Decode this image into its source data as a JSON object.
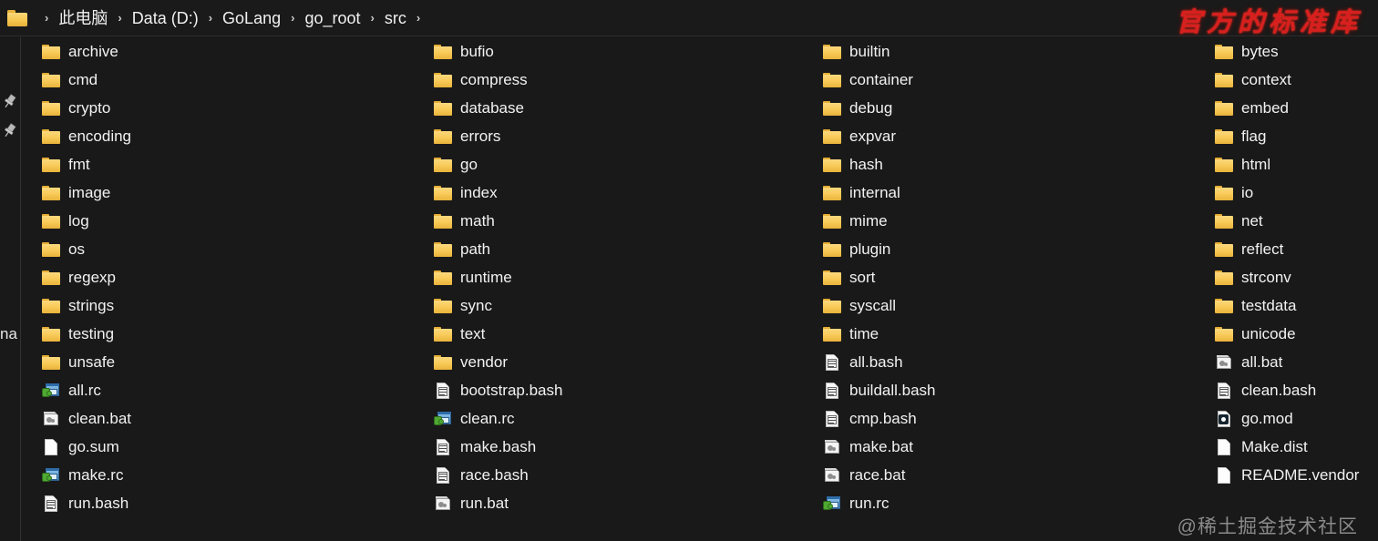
{
  "breadcrumb": {
    "folder_icon": "folder-icon",
    "separator": "›",
    "crumbs": [
      "此电脑",
      "Data (D:)",
      "GoLang",
      "go_root",
      "src"
    ]
  },
  "header": {
    "stamp_text": "官方的标准库",
    "stamp_color": "#d81f1f"
  },
  "left_rail": {
    "pins": [
      "pin-icon",
      "pin-icon"
    ],
    "clipped_label": "na"
  },
  "watermark": "@稀土掘金技术社区",
  "colors": {
    "background": "#191919",
    "text": "#f2f2f2",
    "folder": "#f8ca58",
    "accent_red": "#d81f1f",
    "divider": "#333333"
  },
  "columns": [
    {
      "items": [
        {
          "name": "archive",
          "icon": "folder-icon",
          "type": "folder"
        },
        {
          "name": "cmd",
          "icon": "folder-icon",
          "type": "folder"
        },
        {
          "name": "crypto",
          "icon": "folder-icon",
          "type": "folder"
        },
        {
          "name": "encoding",
          "icon": "folder-icon",
          "type": "folder"
        },
        {
          "name": "fmt",
          "icon": "folder-icon",
          "type": "folder"
        },
        {
          "name": "image",
          "icon": "folder-icon",
          "type": "folder"
        },
        {
          "name": "log",
          "icon": "folder-icon",
          "type": "folder"
        },
        {
          "name": "os",
          "icon": "folder-icon",
          "type": "folder"
        },
        {
          "name": "regexp",
          "icon": "folder-icon",
          "type": "folder"
        },
        {
          "name": "strings",
          "icon": "folder-icon",
          "type": "folder"
        },
        {
          "name": "testing",
          "icon": "folder-icon",
          "type": "folder"
        },
        {
          "name": "unsafe",
          "icon": "folder-icon",
          "type": "folder"
        },
        {
          "name": "all.rc",
          "icon": "rc-file-icon",
          "type": "rc"
        },
        {
          "name": "clean.bat",
          "icon": "bat-file-icon",
          "type": "bat"
        },
        {
          "name": "go.sum",
          "icon": "page-file-icon",
          "type": "page"
        },
        {
          "name": "make.rc",
          "icon": "rc-file-icon",
          "type": "rc"
        },
        {
          "name": "run.bash",
          "icon": "textdoc-file-icon",
          "type": "textdoc"
        }
      ]
    },
    {
      "items": [
        {
          "name": "bufio",
          "icon": "folder-icon",
          "type": "folder"
        },
        {
          "name": "compress",
          "icon": "folder-icon",
          "type": "folder"
        },
        {
          "name": "database",
          "icon": "folder-icon",
          "type": "folder"
        },
        {
          "name": "errors",
          "icon": "folder-icon",
          "type": "folder"
        },
        {
          "name": "go",
          "icon": "folder-icon",
          "type": "folder"
        },
        {
          "name": "index",
          "icon": "folder-icon",
          "type": "folder"
        },
        {
          "name": "math",
          "icon": "folder-icon",
          "type": "folder"
        },
        {
          "name": "path",
          "icon": "folder-icon",
          "type": "folder"
        },
        {
          "name": "runtime",
          "icon": "folder-icon",
          "type": "folder"
        },
        {
          "name": "sync",
          "icon": "folder-icon",
          "type": "folder"
        },
        {
          "name": "text",
          "icon": "folder-icon",
          "type": "folder"
        },
        {
          "name": "vendor",
          "icon": "folder-icon",
          "type": "folder"
        },
        {
          "name": "bootstrap.bash",
          "icon": "textdoc-file-icon",
          "type": "textdoc"
        },
        {
          "name": "clean.rc",
          "icon": "rc-file-icon",
          "type": "rc"
        },
        {
          "name": "make.bash",
          "icon": "textdoc-file-icon",
          "type": "textdoc"
        },
        {
          "name": "race.bash",
          "icon": "textdoc-file-icon",
          "type": "textdoc"
        },
        {
          "name": "run.bat",
          "icon": "bat-file-icon",
          "type": "bat"
        }
      ]
    },
    {
      "items": [
        {
          "name": "builtin",
          "icon": "folder-icon",
          "type": "folder"
        },
        {
          "name": "container",
          "icon": "folder-icon",
          "type": "folder"
        },
        {
          "name": "debug",
          "icon": "folder-icon",
          "type": "folder"
        },
        {
          "name": "expvar",
          "icon": "folder-icon",
          "type": "folder"
        },
        {
          "name": "hash",
          "icon": "folder-icon",
          "type": "folder"
        },
        {
          "name": "internal",
          "icon": "folder-icon",
          "type": "folder"
        },
        {
          "name": "mime",
          "icon": "folder-icon",
          "type": "folder"
        },
        {
          "name": "plugin",
          "icon": "folder-icon",
          "type": "folder"
        },
        {
          "name": "sort",
          "icon": "folder-icon",
          "type": "folder"
        },
        {
          "name": "syscall",
          "icon": "folder-icon",
          "type": "folder"
        },
        {
          "name": "time",
          "icon": "folder-icon",
          "type": "folder"
        },
        {
          "name": "all.bash",
          "icon": "textdoc-file-icon",
          "type": "textdoc"
        },
        {
          "name": "buildall.bash",
          "icon": "textdoc-file-icon",
          "type": "textdoc"
        },
        {
          "name": "cmp.bash",
          "icon": "textdoc-file-icon",
          "type": "textdoc"
        },
        {
          "name": "make.bat",
          "icon": "bat-file-icon",
          "type": "bat"
        },
        {
          "name": "race.bat",
          "icon": "bat-file-icon",
          "type": "bat"
        },
        {
          "name": "run.rc",
          "icon": "rc-file-icon",
          "type": "rc"
        }
      ]
    },
    {
      "items": [
        {
          "name": "bytes",
          "icon": "folder-icon",
          "type": "folder"
        },
        {
          "name": "context",
          "icon": "folder-icon",
          "type": "folder"
        },
        {
          "name": "embed",
          "icon": "folder-icon",
          "type": "folder"
        },
        {
          "name": "flag",
          "icon": "folder-icon",
          "type": "folder"
        },
        {
          "name": "html",
          "icon": "folder-icon",
          "type": "folder"
        },
        {
          "name": "io",
          "icon": "folder-icon",
          "type": "folder"
        },
        {
          "name": "net",
          "icon": "folder-icon",
          "type": "folder"
        },
        {
          "name": "reflect",
          "icon": "folder-icon",
          "type": "folder"
        },
        {
          "name": "strconv",
          "icon": "folder-icon",
          "type": "folder"
        },
        {
          "name": "testdata",
          "icon": "folder-icon",
          "type": "folder"
        },
        {
          "name": "unicode",
          "icon": "folder-icon",
          "type": "folder"
        },
        {
          "name": "all.bat",
          "icon": "bat-file-icon",
          "type": "bat"
        },
        {
          "name": "clean.bash",
          "icon": "textdoc-file-icon",
          "type": "textdoc"
        },
        {
          "name": "go.mod",
          "icon": "mod-file-icon",
          "type": "mod"
        },
        {
          "name": "Make.dist",
          "icon": "page-file-icon",
          "type": "page"
        },
        {
          "name": "README.vendor",
          "icon": "page-file-icon",
          "type": "page"
        }
      ]
    }
  ]
}
